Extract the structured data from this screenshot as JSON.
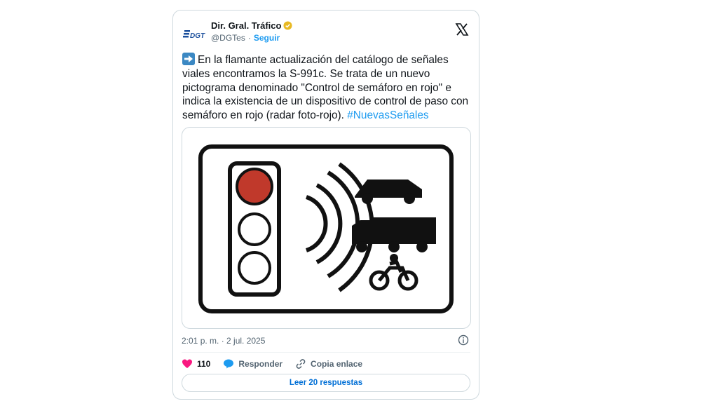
{
  "tweet": {
    "author_name": "Dir. Gral. Tráfico",
    "handle": "@DGTes",
    "separator": "·",
    "follow_label": "Seguir",
    "logo_text": "DGT",
    "text_main": "En la flamante actualización del catálogo de señales viales encontramos la S-991c. Se trata de un nuevo pictograma denominado \"Control de semáforo en rojo\" e indica la existencia de un dispositivo de control de paso con semáforo en rojo (radar foto-rojo).",
    "hashtag": "#NuevasSeñales",
    "timestamp": "2:01 p. m. · 2 jul. 2025",
    "likes_count": "110",
    "reply_label": "Responder",
    "copy_link_label": "Copia enlace",
    "read_replies_label": "Leer 20 respuestas"
  },
  "colors": {
    "accent": "#1d9bf0",
    "like": "#f91880",
    "reply_bubble": "#1d9bf0",
    "red_light": "#c0392b",
    "verified": "#e8b923"
  },
  "icons": [
    "dgt-logo",
    "verified-badge-icon",
    "x-logo-icon",
    "arrow-right-icon",
    "info-icon",
    "heart-icon",
    "reply-bubble-icon",
    "link-icon"
  ]
}
